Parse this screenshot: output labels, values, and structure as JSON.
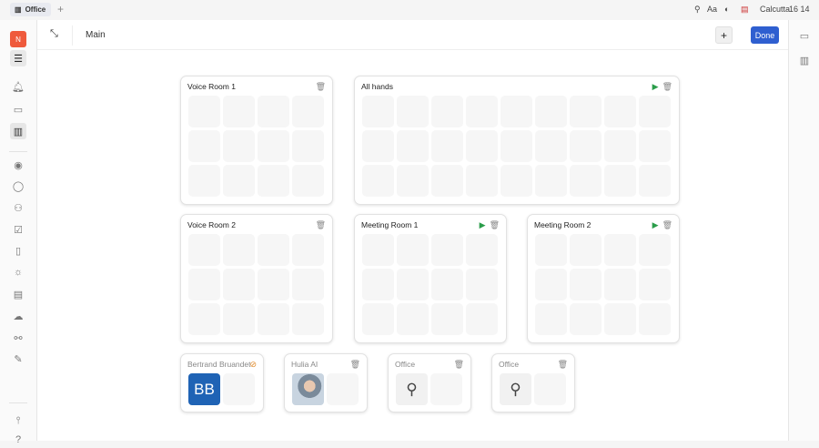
{
  "tabs": [
    {
      "label": "Office"
    }
  ],
  "topbar": {
    "font_label": "Aa",
    "location": "Calcutta",
    "time": "16 14"
  },
  "user": {
    "initial": "N"
  },
  "header": {
    "title": "Main",
    "add_label": "+",
    "done_label": "Done"
  },
  "colors": {
    "accent": "#2f5fd0",
    "avatar": "#ef5a3c",
    "bb": "#1f63b5"
  },
  "rooms": [
    {
      "name": "Voice Room 1",
      "cols": 4,
      "rows": 3,
      "video": false
    },
    {
      "name": "All hands",
      "cols": 9,
      "rows": 3,
      "video": true
    },
    {
      "name": "Voice Room 2",
      "cols": 4,
      "rows": 3,
      "video": false
    },
    {
      "name": "Meeting Room 1",
      "cols": 4,
      "rows": 3,
      "video": true
    },
    {
      "name": "Meeting Room 2",
      "cols": 4,
      "rows": 3,
      "video": true
    }
  ],
  "offices": [
    {
      "name": "Bertrand Bruandet",
      "avatar": "BB",
      "kind": "initials"
    },
    {
      "name": "Hulia AI",
      "kind": "photo"
    },
    {
      "name": "Office",
      "kind": "person"
    },
    {
      "name": "Office",
      "kind": "person"
    }
  ]
}
